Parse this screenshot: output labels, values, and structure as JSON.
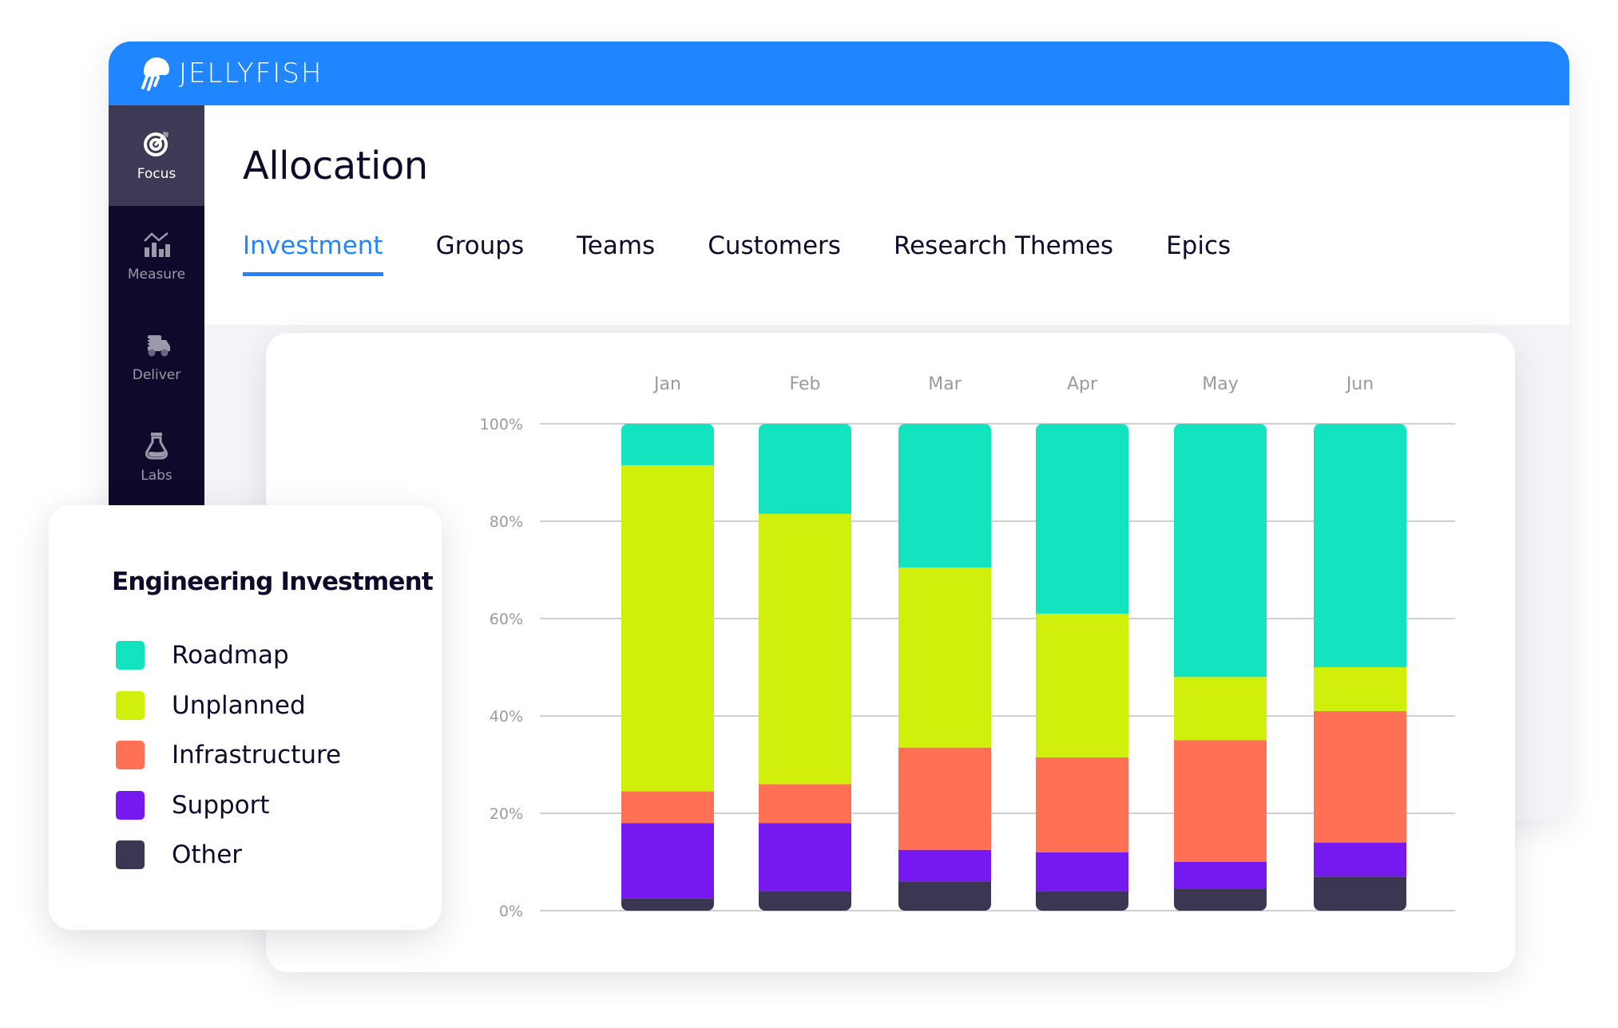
{
  "app": {
    "brand": "JELLYFISH",
    "logo_icon": "jellyfish-logo-icon"
  },
  "sidebar": {
    "items": [
      {
        "label": "Focus",
        "icon": "target-icon",
        "active": true
      },
      {
        "label": "Measure",
        "icon": "bar-chart-trend-icon",
        "active": false
      },
      {
        "label": "Deliver",
        "icon": "delivery-truck-icon",
        "active": false
      },
      {
        "label": "Labs",
        "icon": "flask-icon",
        "active": false
      }
    ]
  },
  "page": {
    "title": "Allocation",
    "tabs": [
      {
        "label": "Investment",
        "active": true
      },
      {
        "label": "Groups",
        "active": false
      },
      {
        "label": "Teams",
        "active": false
      },
      {
        "label": "Customers",
        "active": false
      },
      {
        "label": "Research Themes",
        "active": false
      },
      {
        "label": "Epics",
        "active": false
      }
    ]
  },
  "legend": {
    "title": "Engineering Investment",
    "items": [
      {
        "label": "Roadmap",
        "color": "#14e3c0"
      },
      {
        "label": "Unplanned",
        "color": "#d0f00c"
      },
      {
        "label": "Infrastructure",
        "color": "#ff7054"
      },
      {
        "label": "Support",
        "color": "#7519f0"
      },
      {
        "label": "Other",
        "color": "#3b3753"
      }
    ]
  },
  "chart_data": {
    "type": "bar",
    "stacked": true,
    "title": "Engineering Investment",
    "xlabel": "",
    "ylabel": "",
    "categories": [
      "Jan",
      "Feb",
      "Mar",
      "Apr",
      "May",
      "Jun"
    ],
    "y_ticks": [
      "0%",
      "20%",
      "40%",
      "60%",
      "80%",
      "100%"
    ],
    "ylim": [
      0,
      100
    ],
    "grid": true,
    "x_axis_position": "top",
    "legend_position": "left",
    "series": [
      {
        "name": "Other",
        "color": "#3b3753",
        "values": [
          2.5,
          4,
          6,
          4,
          4.5,
          7
        ]
      },
      {
        "name": "Support",
        "color": "#7519f0",
        "values": [
          15.5,
          14,
          6.5,
          8,
          5.5,
          7
        ]
      },
      {
        "name": "Infrastructure",
        "color": "#ff7054",
        "values": [
          6.5,
          8,
          21,
          19.5,
          25,
          27
        ]
      },
      {
        "name": "Unplanned",
        "color": "#d0f00c",
        "values": [
          67,
          55.5,
          37,
          29.5,
          13,
          9
        ]
      },
      {
        "name": "Roadmap",
        "color": "#14e3c0",
        "values": [
          8.5,
          18.5,
          29.5,
          39,
          52,
          50
        ]
      }
    ]
  }
}
